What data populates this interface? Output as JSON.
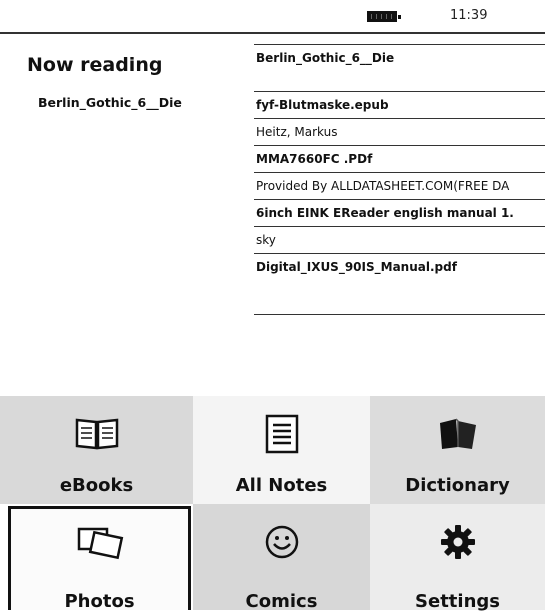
{
  "status": {
    "battery_icon": "battery-icon",
    "time": "11:39"
  },
  "now_reading": {
    "title": "Now reading",
    "item": "Berlin_Gothic_6__Die"
  },
  "recent": {
    "items": [
      {
        "title": "Berlin_Gothic_6__Die",
        "author": ""
      },
      {
        "title": "fyf-Blutmaske.epub",
        "author": "Heitz, Markus"
      },
      {
        "title": "MMA7660FC .PDf",
        "author": "Provided By ALLDATASHEET.COM(FREE DA"
      },
      {
        "title": "6inch EINK EReader english manual 1.",
        "author": "sky"
      },
      {
        "title": "Digital_IXUS_90IS_Manual.pdf",
        "author": ""
      }
    ]
  },
  "menu": {
    "tiles": [
      {
        "label": "eBooks",
        "icon": "open-book-icon"
      },
      {
        "label": "All Notes",
        "icon": "notes-icon"
      },
      {
        "label": "Dictionary",
        "icon": "dictionary-icon"
      },
      {
        "label": "Photos",
        "icon": "photos-icon"
      },
      {
        "label": "Comics",
        "icon": "smiley-icon"
      },
      {
        "label": "Settings",
        "icon": "gear-icon"
      }
    ],
    "selected": "Photos"
  }
}
